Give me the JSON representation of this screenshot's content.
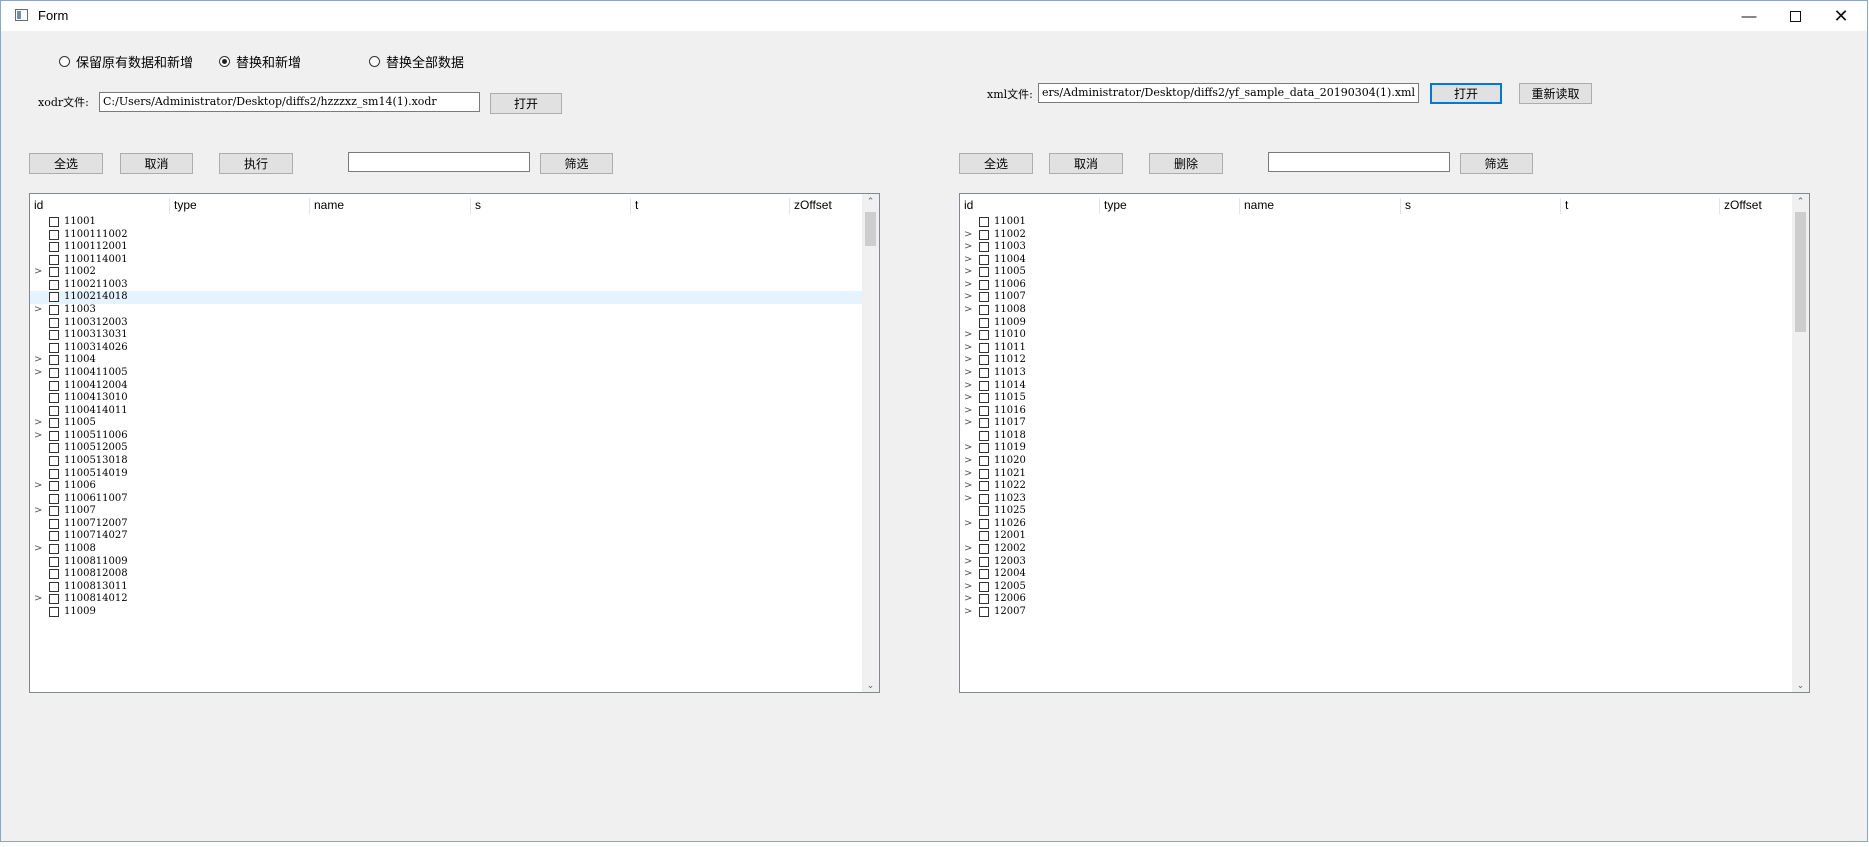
{
  "window": {
    "title": "Form",
    "minimize_icon": "minimize-icon",
    "maximize_icon": "maximize-icon",
    "close_icon": "close-icon"
  },
  "options": {
    "keep": {
      "label": "保留原有数据和新增",
      "checked": false
    },
    "replace_add": {
      "label": "替换和新增",
      "checked": true
    },
    "replace_all": {
      "label": "替换全部数据",
      "checked": false
    }
  },
  "left": {
    "file_label": "xodr文件:",
    "file_path": "C:/Users/Administrator/Desktop/diffs2/hzzzxz_sm14(1).xodr",
    "open_button": "打开",
    "select_all_button": "全选",
    "cancel_button": "取消",
    "execute_button": "执行",
    "filter_value": "",
    "filter_button": "筛选",
    "columns": [
      "id",
      "type",
      "name",
      "s",
      "t",
      "zOffset"
    ],
    "rows": [
      {
        "id": "11001",
        "expandable": false
      },
      {
        "id": "1100111002",
        "expandable": false
      },
      {
        "id": "1100112001",
        "expandable": false
      },
      {
        "id": "1100114001",
        "expandable": false
      },
      {
        "id": "11002",
        "expandable": true
      },
      {
        "id": "1100211003",
        "expandable": false
      },
      {
        "id": "1100214018",
        "expandable": false,
        "selected": true
      },
      {
        "id": "11003",
        "expandable": true
      },
      {
        "id": "1100312003",
        "expandable": false
      },
      {
        "id": "1100313031",
        "expandable": false
      },
      {
        "id": "1100314026",
        "expandable": false
      },
      {
        "id": "11004",
        "expandable": true
      },
      {
        "id": "1100411005",
        "expandable": true
      },
      {
        "id": "1100412004",
        "expandable": false
      },
      {
        "id": "1100413010",
        "expandable": false
      },
      {
        "id": "1100414011",
        "expandable": false
      },
      {
        "id": "11005",
        "expandable": true
      },
      {
        "id": "1100511006",
        "expandable": true
      },
      {
        "id": "1100512005",
        "expandable": false
      },
      {
        "id": "1100513018",
        "expandable": false
      },
      {
        "id": "1100514019",
        "expandable": false
      },
      {
        "id": "11006",
        "expandable": true
      },
      {
        "id": "1100611007",
        "expandable": false
      },
      {
        "id": "11007",
        "expandable": true
      },
      {
        "id": "1100712007",
        "expandable": false
      },
      {
        "id": "1100714027",
        "expandable": false
      },
      {
        "id": "11008",
        "expandable": true
      },
      {
        "id": "1100811009",
        "expandable": false
      },
      {
        "id": "1100812008",
        "expandable": false
      },
      {
        "id": "1100813011",
        "expandable": false
      },
      {
        "id": "1100814012",
        "expandable": true
      },
      {
        "id": "11009",
        "expandable": false
      }
    ]
  },
  "right": {
    "file_label": "xml文件:",
    "file_path": "ers/Administrator/Desktop/diffs2/yf_sample_data_20190304(1).xml",
    "open_button": "打开",
    "reload_button": "重新读取",
    "select_all_button": "全选",
    "cancel_button": "取消",
    "delete_button": "删除",
    "filter_value": "",
    "filter_button": "筛选",
    "columns": [
      "id",
      "type",
      "name",
      "s",
      "t",
      "zOffset"
    ],
    "rows": [
      {
        "id": "11001",
        "expandable": false
      },
      {
        "id": "11002",
        "expandable": true
      },
      {
        "id": "11003",
        "expandable": true
      },
      {
        "id": "11004",
        "expandable": true
      },
      {
        "id": "11005",
        "expandable": true
      },
      {
        "id": "11006",
        "expandable": true
      },
      {
        "id": "11007",
        "expandable": true
      },
      {
        "id": "11008",
        "expandable": true
      },
      {
        "id": "11009",
        "expandable": false
      },
      {
        "id": "11010",
        "expandable": true
      },
      {
        "id": "11011",
        "expandable": true
      },
      {
        "id": "11012",
        "expandable": true
      },
      {
        "id": "11013",
        "expandable": true
      },
      {
        "id": "11014",
        "expandable": true
      },
      {
        "id": "11015",
        "expandable": true
      },
      {
        "id": "11016",
        "expandable": true
      },
      {
        "id": "11017",
        "expandable": true
      },
      {
        "id": "11018",
        "expandable": false
      },
      {
        "id": "11019",
        "expandable": true
      },
      {
        "id": "11020",
        "expandable": true
      },
      {
        "id": "11021",
        "expandable": true
      },
      {
        "id": "11022",
        "expandable": true
      },
      {
        "id": "11023",
        "expandable": true
      },
      {
        "id": "11025",
        "expandable": false
      },
      {
        "id": "11026",
        "expandable": true
      },
      {
        "id": "12001",
        "expandable": false
      },
      {
        "id": "12002",
        "expandable": true
      },
      {
        "id": "12003",
        "expandable": true
      },
      {
        "id": "12004",
        "expandable": true
      },
      {
        "id": "12005",
        "expandable": true
      },
      {
        "id": "12006",
        "expandable": true
      },
      {
        "id": "12007",
        "expandable": true
      }
    ]
  }
}
